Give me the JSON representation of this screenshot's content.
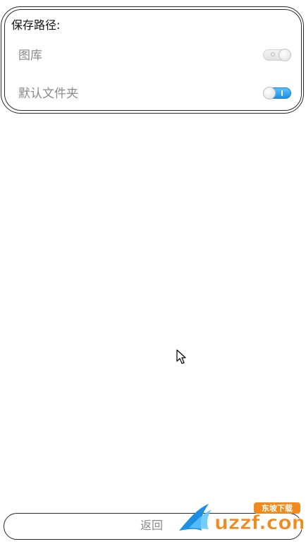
{
  "settings_panel": {
    "title": "保存路径:",
    "rows": [
      {
        "label": "图库",
        "toggle_on": false
      },
      {
        "label": "默认文件夹",
        "toggle_on": true
      }
    ]
  },
  "footer": {
    "back_label": "返回"
  },
  "watermark": {
    "brand": "uzzf.com",
    "tagline": "东坡下载"
  },
  "colors": {
    "toggle_on": "#2a9cf0",
    "label_gray": "#8a8a8a",
    "watermark_orange": "#f08a1c",
    "watermark_blue": "#1e8fe0"
  }
}
